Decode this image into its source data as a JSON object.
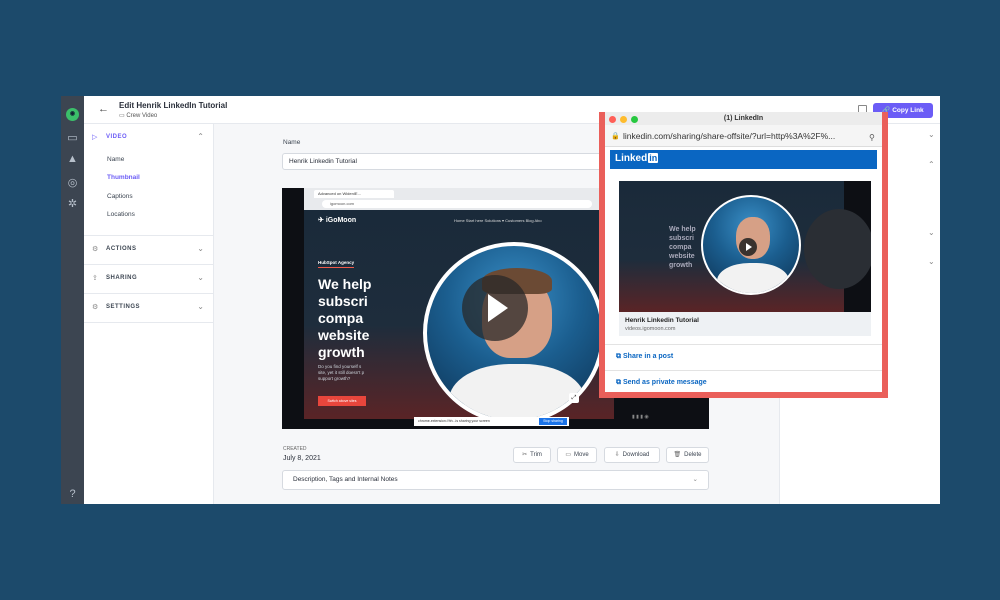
{
  "app": {
    "title": "Edit Henrik LinkedIn Tutorial",
    "folder": "Crew Video",
    "copy_link": "Copy Link",
    "more": "•••",
    "back": "←"
  },
  "sidebar": {
    "video": {
      "label": "VIDEO",
      "items": [
        "Name",
        "Thumbnail",
        "Captions",
        "Locations"
      ],
      "selected": "Thumbnail"
    },
    "actions": "ACTIONS",
    "sharing": "SHARING",
    "settings": "SETTINGS"
  },
  "main": {
    "name_label": "Name",
    "name_value": "Henrik Linkedin Tutorial",
    "created_label": "CREATED",
    "created_value": "July 8, 2021",
    "buttons": {
      "trim": "Trim",
      "move": "Move",
      "download": "Download",
      "delete": "Delete"
    },
    "description": "Description, Tags and Internal Notes"
  },
  "video_frame": {
    "tab": "Advanced on WidenIE...",
    "url": "igomoon.com",
    "site_logo": "iGoMoon",
    "nav": "Home   Start here   Solutions ▾   Customers   Blog   Abo",
    "agency": "HubSpot Agency",
    "hero": [
      "We help",
      "subscri",
      "compa",
      "website",
      "growth"
    ],
    "sub": [
      "Do you find yourself s",
      "site, yet it still doesn't p",
      "support growth?"
    ],
    "cta": "Switch above sites",
    "share_text": "chrome-extension://hh...is sharing your screen",
    "stop": "Stop sharing"
  },
  "linkedin": {
    "window_title": "(1) LinkedIn",
    "url": "linkedin.com/sharing/share-offsite/?url=http%3A%2F%...",
    "brand": "Linked",
    "brand_in": "in",
    "card_title": "Henrik Linkedin Tutorial",
    "card_domain": "videos.igomoon.com",
    "share_post": "Share in a post",
    "send_private": "Send as private message",
    "thumb_hero": [
      "We help",
      "subscri",
      "compa",
      "website",
      "growth"
    ]
  },
  "colors": {
    "accent": "#6b5cf6",
    "linkedin": "#0a66c2",
    "background": "#1c4a6b",
    "popup_border": "#ea5f5a"
  }
}
